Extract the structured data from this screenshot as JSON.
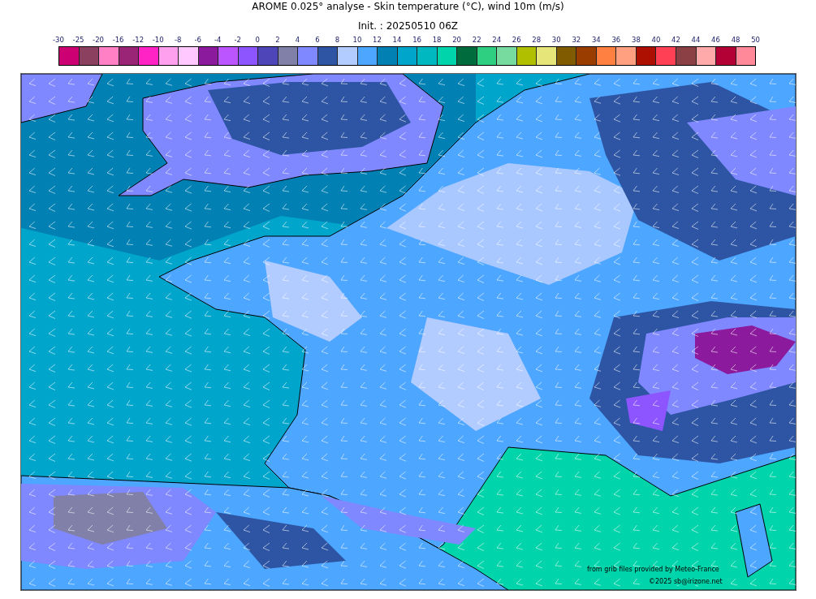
{
  "title": "AROME 0.025° analyse - Skin temperature (°C), wind 10m (m/s)",
  "subtitle": "Init. : 20250510 06Z",
  "colorbar": {
    "ticks": [
      "-30",
      "-25",
      "-20",
      "-16",
      "-12",
      "-10",
      "-8",
      "-6",
      "-4",
      "-2",
      "0",
      "2",
      "4",
      "6",
      "8",
      "10",
      "12",
      "14",
      "16",
      "18",
      "20",
      "22",
      "24",
      "26",
      "28",
      "30",
      "32",
      "34",
      "36",
      "38",
      "40",
      "42",
      "44",
      "46",
      "48",
      "50"
    ],
    "bands": [
      {
        "color": "#cc0073"
      },
      {
        "color": "#8b4060"
      },
      {
        "color": "#ff80c4"
      },
      {
        "color": "#9a2577"
      },
      {
        "color": "#ff22c4"
      },
      {
        "color": "#ffa0ee"
      },
      {
        "color": "#ffc8ff"
      },
      {
        "color": "#8c1a9c"
      },
      {
        "color": "#bb55ff"
      },
      {
        "color": "#8c55ff"
      },
      {
        "color": "#4d45b8"
      },
      {
        "color": "#8080a8"
      },
      {
        "color": "#8088ff"
      },
      {
        "color": "#2e55a3"
      },
      {
        "color": "#b3ccff"
      },
      {
        "color": "#4da6ff"
      },
      {
        "color": "#0080b3"
      },
      {
        "color": "#00a5cc"
      },
      {
        "color": "#00b8c0"
      },
      {
        "color": "#00d4aa"
      },
      {
        "color": "#006b3c"
      },
      {
        "color": "#2ecf80"
      },
      {
        "color": "#77db9f"
      },
      {
        "color": "#b0bf00"
      },
      {
        "color": "#e5e57a"
      },
      {
        "color": "#805b00"
      },
      {
        "color": "#993d00"
      },
      {
        "color": "#ff8040"
      },
      {
        "color": "#ffa080"
      },
      {
        "color": "#ad1000"
      },
      {
        "color": "#ff4055"
      },
      {
        "color": "#8b4045"
      },
      {
        "color": "#ffaaaa"
      },
      {
        "color": "#b30035"
      },
      {
        "color": "#ff8899"
      }
    ]
  },
  "attribution": [
    "from grib files provided by Meteo-France",
    "©2025 sb@irizone.net"
  ]
}
